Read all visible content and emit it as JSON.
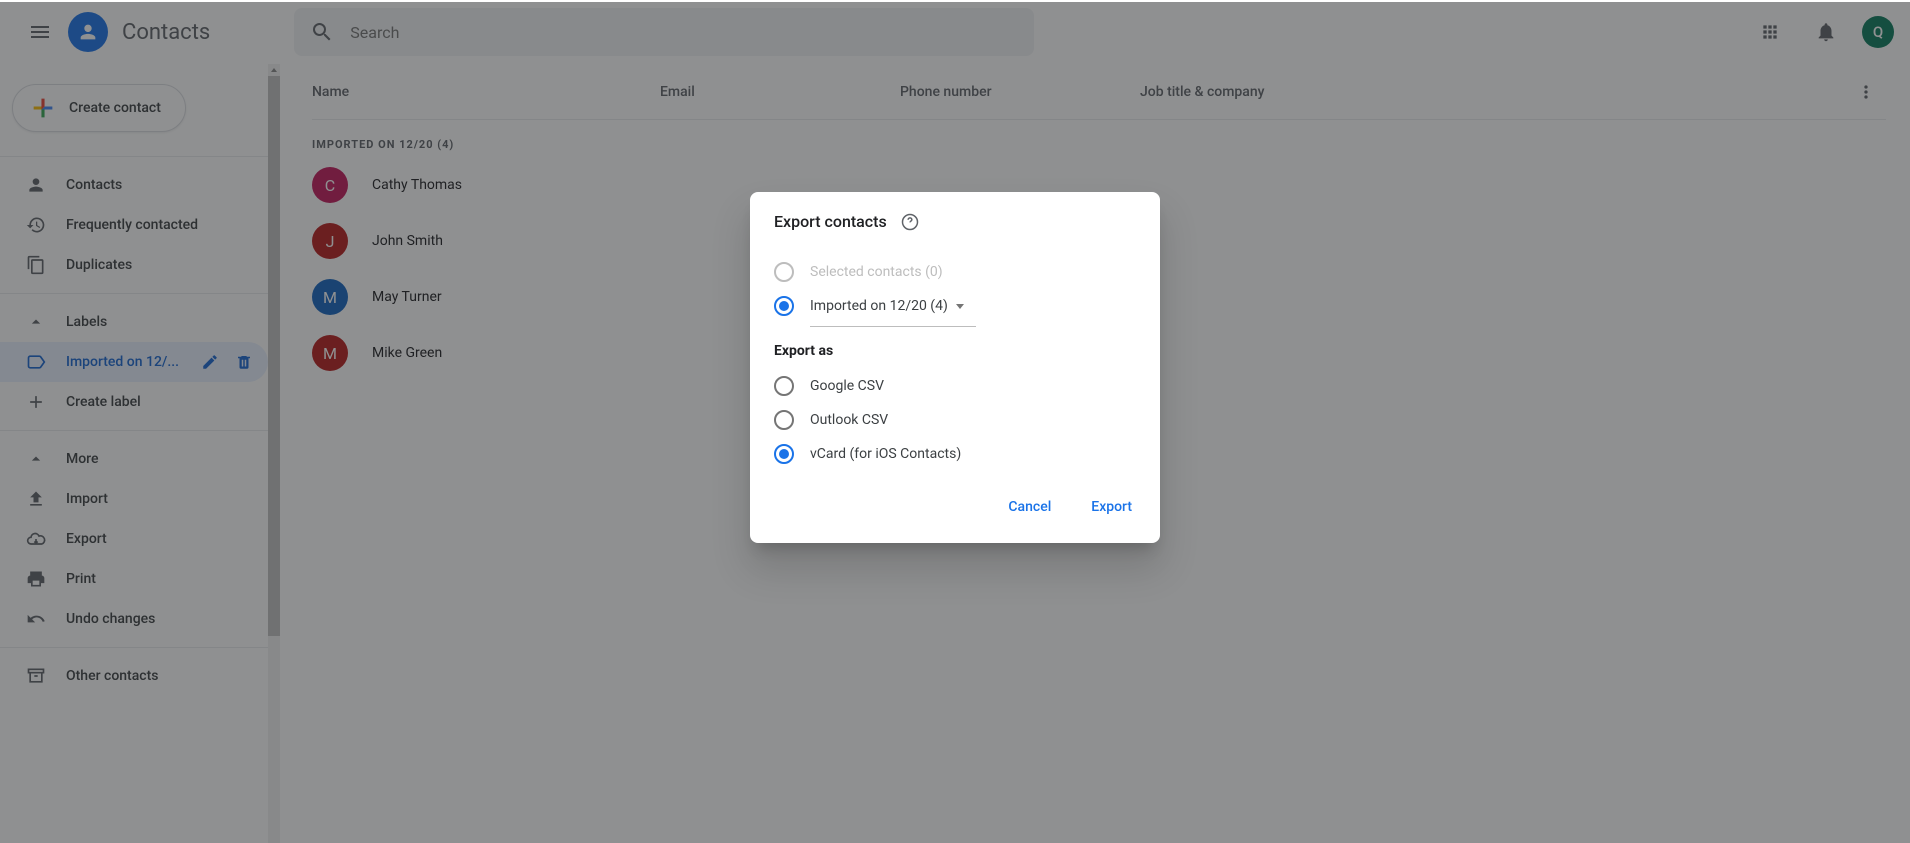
{
  "header": {
    "app_title": "Contacts",
    "search_placeholder": "Search",
    "account_initial": "Q"
  },
  "sidebar": {
    "create_label": "Create contact",
    "nav": [
      {
        "label": "Contacts"
      },
      {
        "label": "Frequently contacted"
      },
      {
        "label": "Duplicates"
      }
    ],
    "labels_header": "Labels",
    "labels": [
      {
        "label": "Imported on 12/..."
      }
    ],
    "create_label_label": "Create label",
    "more_label": "More",
    "actions": [
      {
        "label": "Import"
      },
      {
        "label": "Export"
      },
      {
        "label": "Print"
      },
      {
        "label": "Undo changes"
      }
    ],
    "other_label": "Other contacts"
  },
  "table": {
    "columns": {
      "name": "Name",
      "email": "Email",
      "phone": "Phone number",
      "job": "Job title & company"
    },
    "group_label": "Imported on 12/20 (4)",
    "rows": [
      {
        "initial": "C",
        "name": "Cathy Thomas",
        "color": "#c2185b"
      },
      {
        "initial": "J",
        "name": "John Smith",
        "color": "#b71c1c"
      },
      {
        "initial": "M",
        "name": "May Turner",
        "color": "#1565c0"
      },
      {
        "initial": "M",
        "name": "Mike Green",
        "color": "#b71c1c"
      }
    ]
  },
  "dialog": {
    "title": "Export contacts",
    "scope": {
      "selected_label": "Selected contacts (0)",
      "imported_label": "Imported on 12/20 (4)"
    },
    "export_as_label": "Export as",
    "formats": [
      {
        "label": "Google CSV"
      },
      {
        "label": "Outlook CSV"
      },
      {
        "label": "vCard (for iOS Contacts)"
      }
    ],
    "cancel": "Cancel",
    "export": "Export"
  }
}
